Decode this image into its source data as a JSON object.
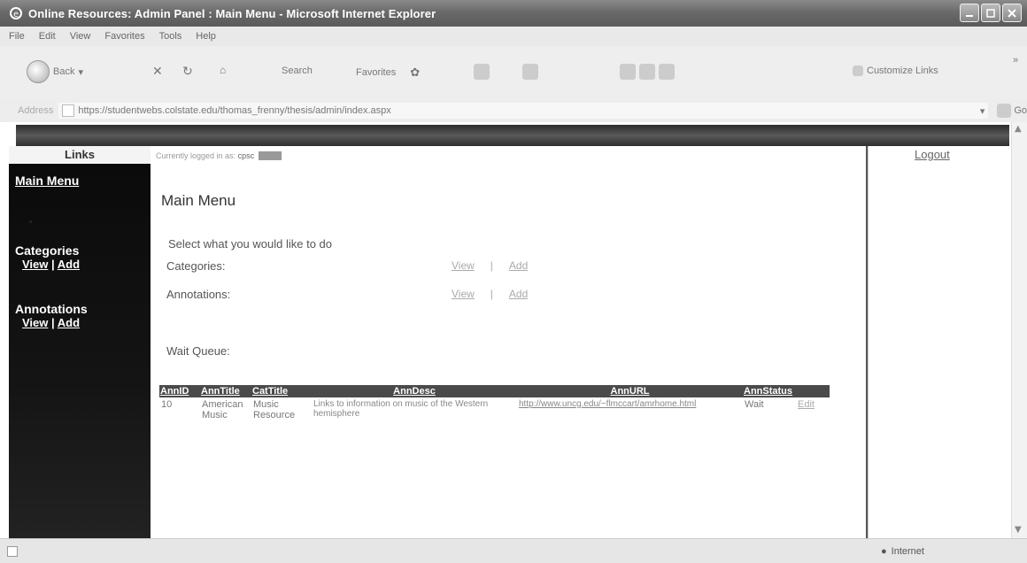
{
  "window": {
    "title": "Online Resources: Admin Panel : Main Menu - Microsoft Internet Explorer"
  },
  "menu": [
    "File",
    "Edit",
    "View",
    "Favorites",
    "Tools",
    "Help"
  ],
  "toolbar": {
    "back": "Back",
    "search": "Search",
    "favorites": "Favorites",
    "customize": "Customize Links"
  },
  "address": {
    "url": "https://studentwebs.colstate.edu/thomas_frenny/thesis/admin/index.aspx",
    "go": "Go"
  },
  "nav": {
    "head": "Links",
    "main_menu": "Main Menu",
    "categories": {
      "label": "Categories",
      "view": "View",
      "sep": "|",
      "add": "Add"
    },
    "annotations": {
      "label": "Annotations",
      "view": "View",
      "sep": "|",
      "add": "Add"
    }
  },
  "content": {
    "logged_prefix": "Currently logged in as:",
    "user": "cpsc",
    "title": "Main Menu",
    "prompt": "Select what you would like to do",
    "rows": [
      {
        "label": "Categories:",
        "view": "View",
        "sep": "|",
        "add": "Add"
      },
      {
        "label": "Annotations:",
        "view": "View",
        "sep": "|",
        "add": "Add"
      }
    ],
    "wait_queue": "Wait Queue:",
    "table": {
      "headers": [
        "AnnID",
        "AnnTitle",
        "CatTitle",
        "AnnDesc",
        "AnnURL",
        "AnnStatus"
      ],
      "rows": [
        {
          "id": "10",
          "title": "American Music",
          "cat": "Music Resource",
          "desc": "Links to information on music of the Western hemisphere",
          "url": "http://www.uncg.edu/~flmccart/amrhome.html",
          "status": "Wait",
          "edit": "Edit"
        }
      ]
    }
  },
  "right": {
    "logout": "Logout"
  },
  "status": {
    "zone": "Internet"
  }
}
